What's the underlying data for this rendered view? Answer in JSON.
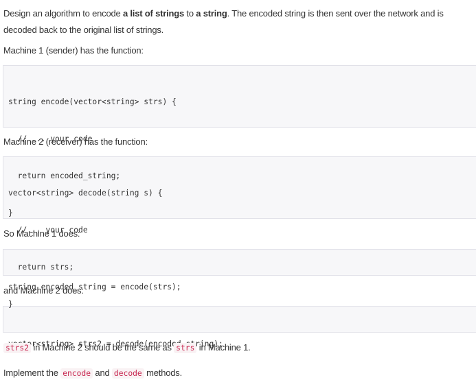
{
  "intro": {
    "t1": "Design an algorithm to encode ",
    "b1": "a list of strings",
    "t2": " to ",
    "b2": "a string",
    "t3": ". The encoded string is then sent over the network and is decoded back to the original list of strings."
  },
  "machine1_label": "Machine 1 (sender) has the function:",
  "code1": [
    "string encode(vector<string> strs) {",
    "  // ... your code",
    "  return encoded_string;",
    "}"
  ],
  "machine2_label": "Machine 2 (receiver) has the function:",
  "code2": [
    "vector<string> decode(string s) {",
    "  //... your code",
    "  return strs;",
    "}"
  ],
  "so_machine1": "So Machine 1 does:",
  "code3": "string encoded_string = encode(strs);",
  "and_machine2": "and Machine 2 does:",
  "code4": "vector<string> strs2 = decode(encoded_string);",
  "same_line": {
    "code_a": "strs2",
    "text_a": " in Machine 2 should be the same as ",
    "code_b": "strs",
    "text_b": " in Machine 1."
  },
  "implement_line": {
    "text_a": "Implement the ",
    "code_a": "encode",
    "text_b": " and ",
    "code_b": "decode",
    "text_c": " methods."
  }
}
